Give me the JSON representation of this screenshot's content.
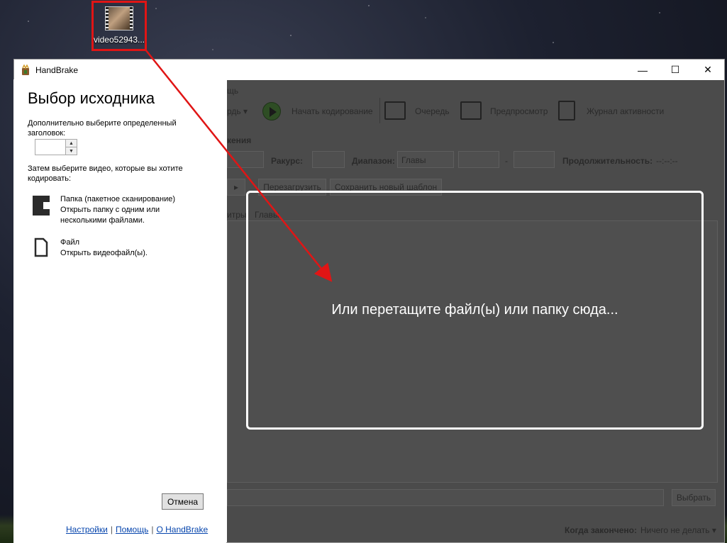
{
  "desktop": {
    "icon_label": "video52943..."
  },
  "window": {
    "title": "HandBrake",
    "minimize": "—",
    "maximize": "☐",
    "close": "✕"
  },
  "main": {
    "menu_fragment": "щь",
    "toolbar": {
      "source_fragment": "рдь ▾",
      "start": "Начать кодирование",
      "queue": "Очередь",
      "preview": "Предпросмотр",
      "activity": "Журнал активности"
    },
    "section_fragment": "кения",
    "angle_label": "Ракурс:",
    "range_label": "Диапазон:",
    "range_value": "Главы",
    "dash": "-",
    "duration_label": "Продолжительность:",
    "duration_value": "--:--:--",
    "reload": "Перезагрузить",
    "save_preset": "Сохранить новый шаблон",
    "tab_fragment": "итры",
    "tab_chapters": "Главы",
    "browse": "Выбрать",
    "when_done_label": "Когда закончено:",
    "when_done_value": "Ничего не делать ▾"
  },
  "drop_overlay": {
    "text": "Или перетащите файл(ы) или папку сюда..."
  },
  "source_panel": {
    "heading": "Выбор исходника",
    "title_note": "Дополнительно выберите определенный заголовок:",
    "videos_note": "Затем выберите видео, которые вы хотите кодировать:",
    "folder": {
      "title": "Папка (пакетное сканирование)",
      "desc": "Открыть папку с одним или несколькими файлами."
    },
    "file": {
      "title": "Файл",
      "desc": "Открыть видеофайл(ы)."
    },
    "cancel": "Отмена",
    "links": {
      "settings": "Настройки",
      "help": "Помощь",
      "about": "О HandBrake",
      "sep": "|"
    }
  },
  "colors": {
    "highlight": "#e01515",
    "drop_border": "#ffffff",
    "link": "#0645ad"
  }
}
